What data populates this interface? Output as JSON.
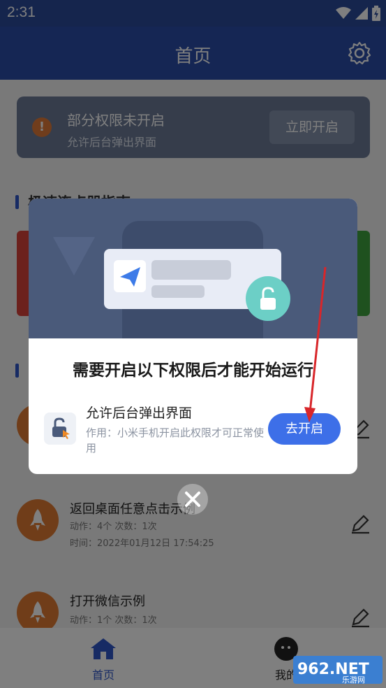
{
  "status_bar": {
    "time": "2:31"
  },
  "app_bar": {
    "title": "首页",
    "settings_icon": "gear-icon"
  },
  "permission_card": {
    "title": "部分权限未开启",
    "subtitle": "允许后台弹出界面",
    "button_label": "立即开启",
    "icon": "warning-icon"
  },
  "section_1": {
    "title": "极速连点器指南"
  },
  "tasks": [
    {
      "name": "",
      "meta_1": "",
      "meta_2": ""
    },
    {
      "name": "返回桌面任意点击示例",
      "meta_1": "动作：4个 次数：1次",
      "meta_2": "时间：2022年01月12日 17:54:25"
    },
    {
      "name": "打开微信示例",
      "meta_1": "动作：1个 次数：1次",
      "meta_2": ""
    }
  ],
  "tabbar": {
    "home_label": "首页",
    "mine_label": "我的"
  },
  "dialog": {
    "headline": "需要开启以下权限后才能开始运行",
    "permission_name": "允许后台弹出界面",
    "permission_desc": "作用：小米手机开启此权限才可正常使用",
    "button_label": "去开启"
  },
  "watermark": {
    "text": "962.NET",
    "sub": "乐游网"
  },
  "colors": {
    "primary": "#2b4da8",
    "accent": "#3d6fe8",
    "teal": "#6ccfc6",
    "orange": "#e07a32",
    "arrow": "#d8262a"
  }
}
